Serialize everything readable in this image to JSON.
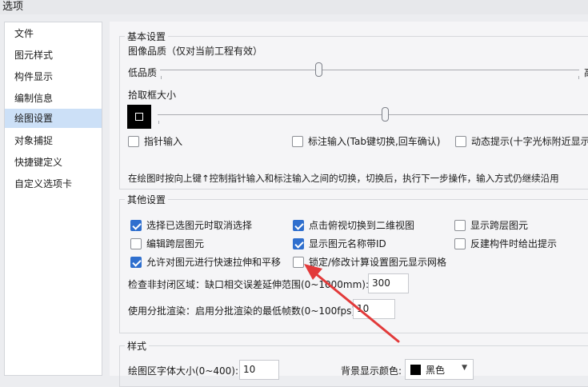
{
  "window": {
    "title": "选项"
  },
  "sidebar": {
    "items": [
      {
        "label": "文件"
      },
      {
        "label": "图元样式"
      },
      {
        "label": "构件显示"
      },
      {
        "label": "编制信息"
      },
      {
        "label": "绘图设置",
        "selected": true
      },
      {
        "label": "对象捕捉"
      },
      {
        "label": "快捷键定义"
      },
      {
        "label": "自定义选项卡"
      }
    ]
  },
  "basic": {
    "title": "基本设置",
    "quality_label": "图像品质（仅对当前工程有效）",
    "quality_low": "低品质",
    "quality_high": "高",
    "pickbox_label": "拾取框大小",
    "check_pointer": {
      "label": "指针输入",
      "checked": false
    },
    "check_dimension": {
      "label": "标注输入(Tab键切换,回车确认)",
      "checked": false
    },
    "check_dynamic": {
      "label": "动态提示(十字光标附近显示",
      "checked": false
    },
    "hint": "在绘图时按向上键↑控制指针输入和标注输入之间的切换，切换后，执行下一步操作，输入方式仍继续沿用"
  },
  "other": {
    "title": "其他设置",
    "checks": [
      {
        "label": "选择已选图元时取消选择",
        "checked": true
      },
      {
        "label": "点击俯视切换到二维视图",
        "checked": true
      },
      {
        "label": "显示跨层图元",
        "checked": false
      },
      {
        "label": "编辑跨层图元",
        "checked": false
      },
      {
        "label": "显示图元名称带ID",
        "checked": true
      },
      {
        "label": "反建构件时给出提示",
        "checked": false
      },
      {
        "label": "允许对图元进行快速拉伸和平移",
        "checked": true
      },
      {
        "label": "锁定/修改计算设置图元显示网格",
        "checked": false
      }
    ],
    "gap_label": "检查非封闭区域：缺口相交误差延伸范围(0~1000mm):",
    "gap_value": "300",
    "batch_label": "使用分批渲染：启用分批渲染的最低帧数(0~100fps):",
    "batch_value": "10"
  },
  "style": {
    "title": "样式",
    "font_label": "绘图区字体大小(0~400):",
    "font_value": "10",
    "bg_label": "背景显示颜色:",
    "bg_value": "黑色"
  },
  "colors": {
    "accent": "#2f6fce",
    "selected_bg": "#cce0f7",
    "annotation": "#e23a3a"
  },
  "icons": {
    "checkmark": "checkmark-icon",
    "dropdown": "chevron-down-icon",
    "annotation": "red-arrow-annotation"
  }
}
